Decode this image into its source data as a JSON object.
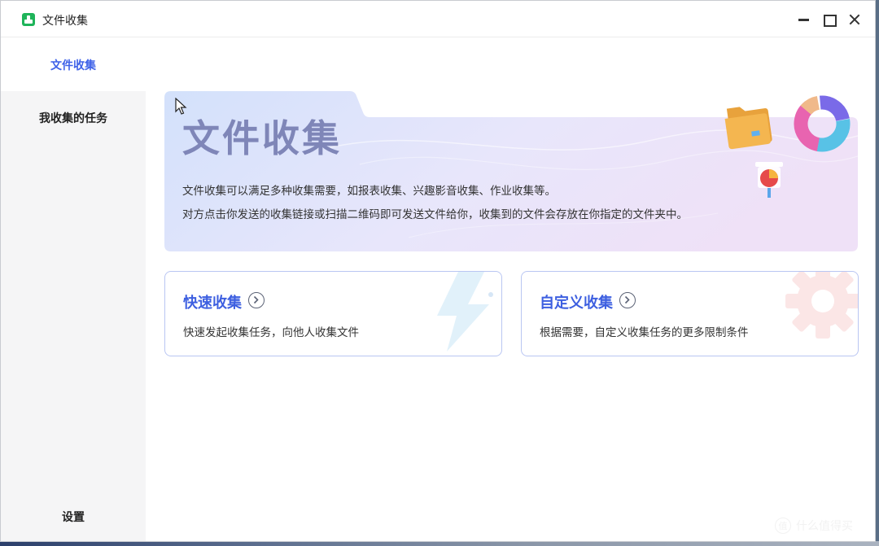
{
  "window": {
    "title": "文件收集"
  },
  "sidebar": {
    "items": [
      {
        "label": "文件收集",
        "active": true
      },
      {
        "label": "我收集的任务",
        "active": false
      }
    ],
    "settings_label": "设置"
  },
  "banner": {
    "title": "文件收集",
    "line1": "文件收集可以满足多种收集需要，如报表收集、兴趣影音收集、作业收集等。",
    "line2": "对方点击你发送的收集链接或扫描二维码即可发送文件给你，收集到的文件会存放在你指定的文件夹中。"
  },
  "cards": [
    {
      "title": "快速收集",
      "description": "快速发起收集任务，向他人收集文件",
      "icon": "lightning-icon"
    },
    {
      "title": "自定义收集",
      "description": "根据需要，自定义收集任务的更多限制条件",
      "icon": "gear-icon"
    }
  ],
  "watermark": {
    "text": "什么值得买",
    "badge": "值"
  },
  "colors": {
    "accent": "#3f62e8",
    "card_border": "#b9c6f2",
    "brand_green": "#1fb45a"
  }
}
